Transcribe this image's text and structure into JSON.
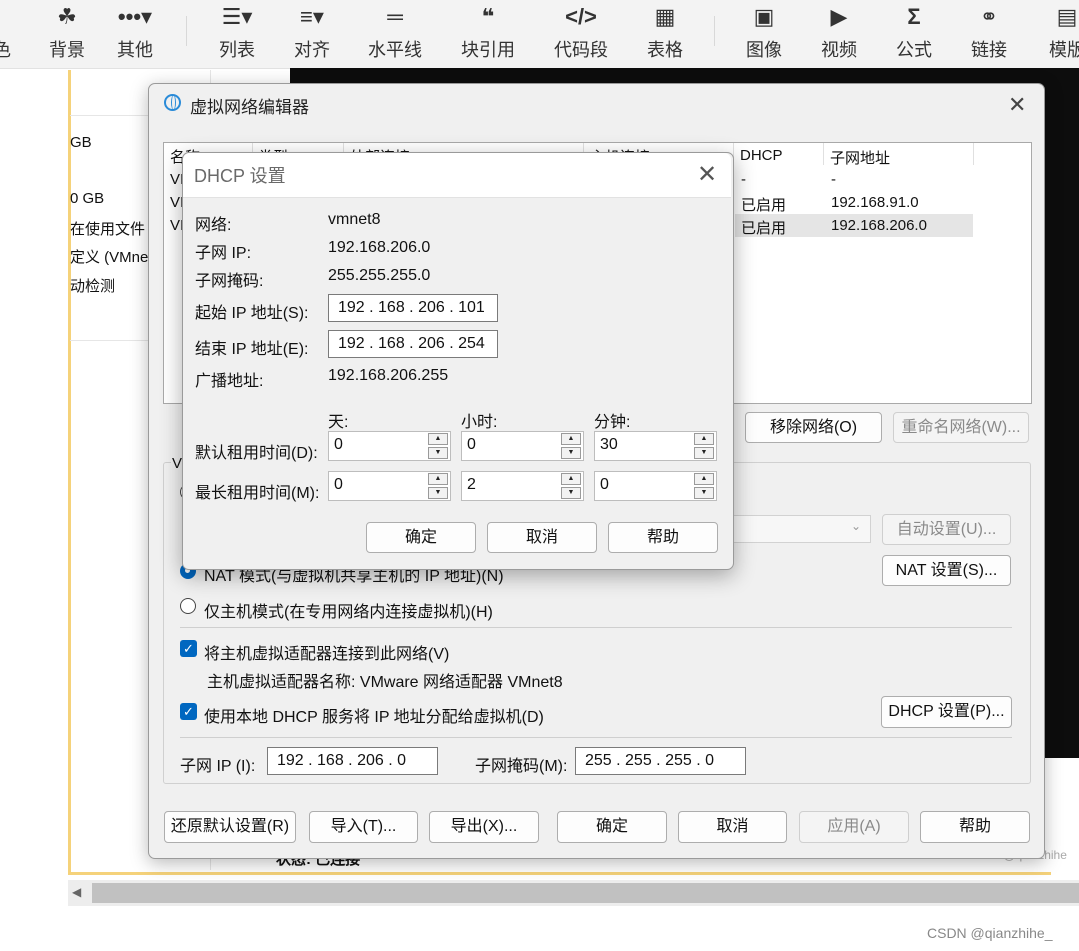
{
  "toolbar": {
    "items": [
      {
        "icon": "paint-bucket-icon",
        "label": "背景"
      },
      {
        "icon": "more-icon",
        "label": "其他"
      },
      {
        "icon": "list-icon",
        "label": "列表"
      },
      {
        "icon": "align-icon",
        "label": "对齐"
      },
      {
        "icon": "horizontal-line-icon",
        "label": "水平线"
      },
      {
        "icon": "quote-icon",
        "label": "块引用"
      },
      {
        "icon": "code-icon",
        "label": "代码段"
      },
      {
        "icon": "table-icon",
        "label": "表格"
      },
      {
        "icon": "image-icon",
        "label": "图像"
      },
      {
        "icon": "video-icon",
        "label": "视频"
      },
      {
        "icon": "formula-icon",
        "label": "公式"
      },
      {
        "icon": "link-icon",
        "label": "链接"
      },
      {
        "icon": "template-icon",
        "label": "模版"
      }
    ],
    "partial_left": "色"
  },
  "background": {
    "lines": [
      "GB",
      "0 GB",
      "在使用文件",
      "定义 (VMne",
      "动检测"
    ],
    "status_text": "状态: 已连接",
    "right_partial": "CSDN @qianzhihe"
  },
  "main_dialog": {
    "title": "虚拟网络编辑器",
    "columns": [
      "名称",
      "类型",
      "外部连接",
      "主机连接",
      "DHCP",
      "子网地址"
    ],
    "rows": [
      {
        "name": "VI",
        "dhcp": "-",
        "subnet": "-"
      },
      {
        "name": "VI",
        "dhcp": "已启用",
        "subnet": "192.168.91.0"
      },
      {
        "name": "VI",
        "dhcp": "已启用",
        "subnet": "192.168.206.0"
      }
    ],
    "remove_network_button": "移除网络(O)",
    "rename_network_button": "重命名网络(W)...",
    "group_label": "VI",
    "auto_settings_button": "自动设置(U)...",
    "nat_mode_label": "NAT 模式(与虚拟机共享主机的 IP 地址)(N)",
    "nat_settings_button": "NAT 设置(S)...",
    "host_only_label": "仅主机模式(在专用网络内连接虚拟机)(H)",
    "connect_adapter_label": "将主机虚拟适配器连接到此网络(V)",
    "adapter_name_label": "主机虚拟适配器名称: VMware 网络适配器 VMnet8",
    "use_dhcp_label": "使用本地 DHCP 服务将 IP 地址分配给虚拟机(D)",
    "dhcp_settings_button": "DHCP 设置(P)...",
    "subnet_ip_label": "子网 IP (I):",
    "subnet_ip_value": "192 . 168 . 206 .   0",
    "subnet_mask_label": "子网掩码(M):",
    "subnet_mask_value": "255 . 255 . 255 .   0",
    "buttons": {
      "restore": "还原默认设置(R)",
      "import": "导入(T)...",
      "export": "导出(X)...",
      "ok": "确定",
      "cancel": "取消",
      "apply": "应用(A)",
      "help": "帮助"
    }
  },
  "dhcp_dialog": {
    "title": "DHCP 设置",
    "network_label": "网络:",
    "network_value": "vmnet8",
    "subnet_ip_label": "子网 IP:",
    "subnet_ip_value": "192.168.206.0",
    "subnet_mask_label": "子网掩码:",
    "subnet_mask_value": "255.255.255.0",
    "start_ip_label": "起始 IP 地址(S):",
    "start_ip_value": "192 . 168 . 206 . 101",
    "end_ip_label": "结束 IP 地址(E):",
    "end_ip_value": "192 . 168 . 206 . 254",
    "broadcast_label": "广播地址:",
    "broadcast_value": "192.168.206.255",
    "col_days": "天:",
    "col_hours": "小时:",
    "col_minutes": "分钟:",
    "default_lease_label": "默认租用时间(D):",
    "default_lease": {
      "days": "0",
      "hours": "0",
      "minutes": "30"
    },
    "max_lease_label": "最长租用时间(M):",
    "max_lease": {
      "days": "0",
      "hours": "2",
      "minutes": "0"
    },
    "ok": "确定",
    "cancel": "取消",
    "help": "帮助"
  },
  "watermark": "CSDN @qianzhihe_"
}
